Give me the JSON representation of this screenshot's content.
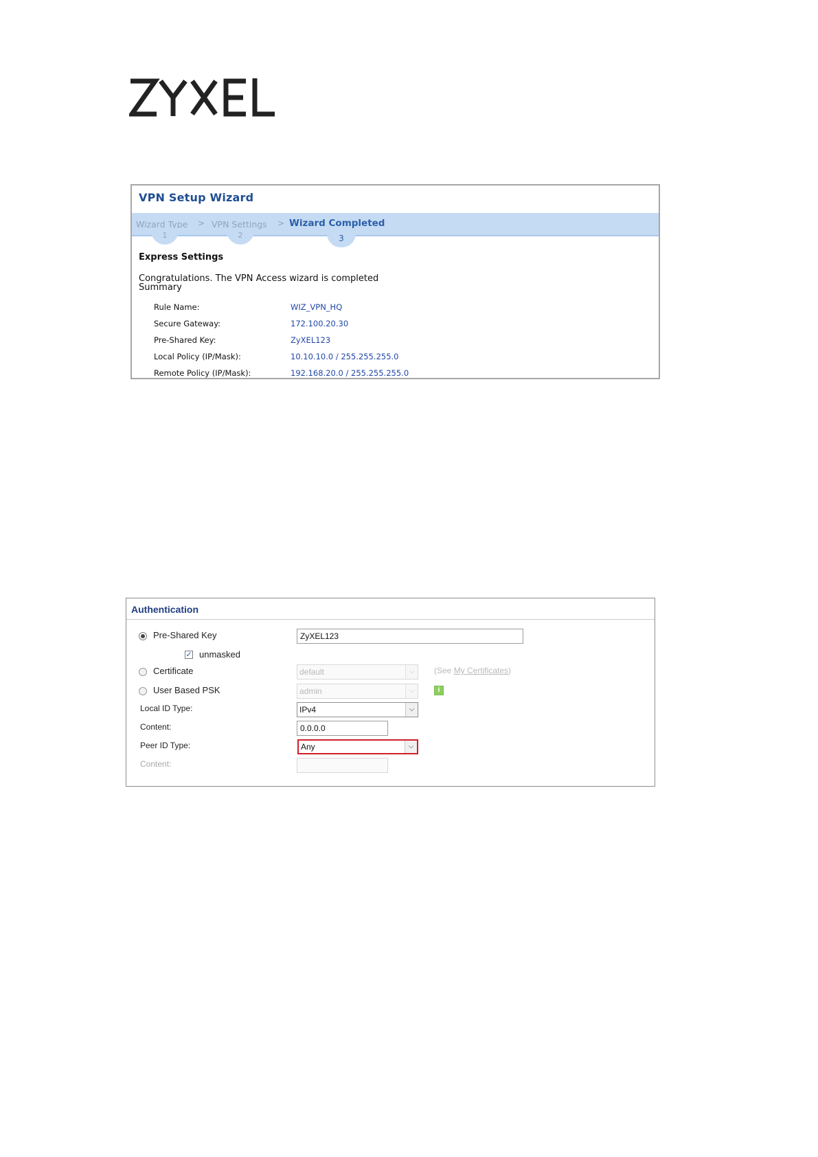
{
  "brand": {
    "logo_text": "ZYXEL"
  },
  "wizard": {
    "title": "VPN Setup Wizard",
    "steps": [
      {
        "label": "Wizard Type",
        "number": "1"
      },
      {
        "label": "VPN Settings",
        "number": "2"
      },
      {
        "label": "Wizard Completed",
        "number": "3"
      }
    ],
    "section_heading": "Express Settings",
    "congrats": "Congratulations. The VPN Access wizard is completed",
    "summary_label": "Summary",
    "summary": [
      {
        "label": "Rule Name:",
        "value": "WIZ_VPN_HQ"
      },
      {
        "label": "Secure Gateway:",
        "value": "172.100.20.30"
      },
      {
        "label": "Pre-Shared Key:",
        "value": "ZyXEL123"
      },
      {
        "label": "Local Policy (IP/Mask):",
        "value": "10.10.10.0 / 255.255.255.0"
      },
      {
        "label": "Remote Policy (IP/Mask):",
        "value": "192.168.20.0 / 255.255.255.0"
      }
    ]
  },
  "auth": {
    "title": "Authentication",
    "psk_label": "Pre-Shared Key",
    "psk_value": "ZyXEL123",
    "unmasked_label": "unmasked",
    "certificate_label": "Certificate",
    "certificate_value": "default",
    "see_prefix": "(See ",
    "see_link": "My Certificates",
    "see_suffix": ")",
    "user_psk_label": "User Based PSK",
    "user_psk_value": "admin",
    "local_id_label": "Local ID Type:",
    "local_id_value": "IPv4",
    "content_label": "Content:",
    "content_value": "0.0.0.0",
    "peer_id_label": "Peer ID Type:",
    "peer_id_value": "Any",
    "peer_content_label": "Content:",
    "peer_content_value": ""
  },
  "colors": {
    "accent": "#1f4e93",
    "highlight": "#d11f2b",
    "step_bar": "#c5dbf3"
  }
}
